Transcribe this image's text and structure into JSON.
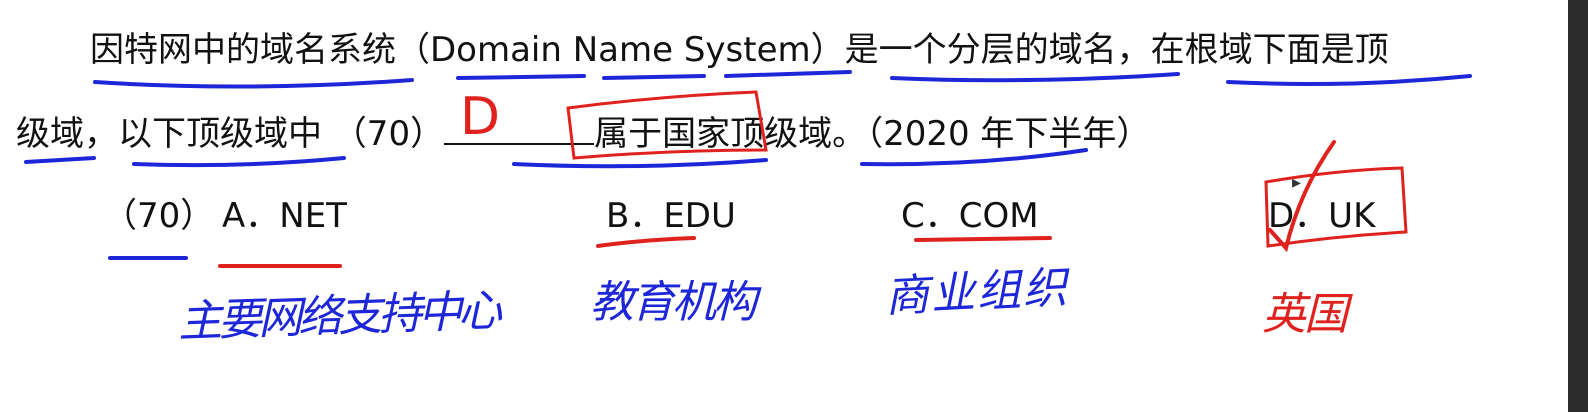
{
  "question": {
    "line1": "因特网中的域名系统（Domain  Name  System）是一个分层的域名，在根域下面是顶",
    "line2_before_blank": "级域，以下顶级域中 （70）",
    "line2_after_blank": "属于国家顶级域。（2020 年下半年）"
  },
  "options": {
    "question_number": "（70）",
    "a": "A．NET",
    "b": "B．EDU",
    "c": "C．COM",
    "d": "D．UK"
  },
  "annotations": {
    "answer": "D",
    "note_a": "主要网络支持中心",
    "note_b": "教育机构",
    "note_c": "商业组织",
    "note_d": "英国"
  },
  "colors": {
    "blue_ink": "#1e27d8",
    "red_ink": "#e0221e",
    "text": "#111111"
  }
}
